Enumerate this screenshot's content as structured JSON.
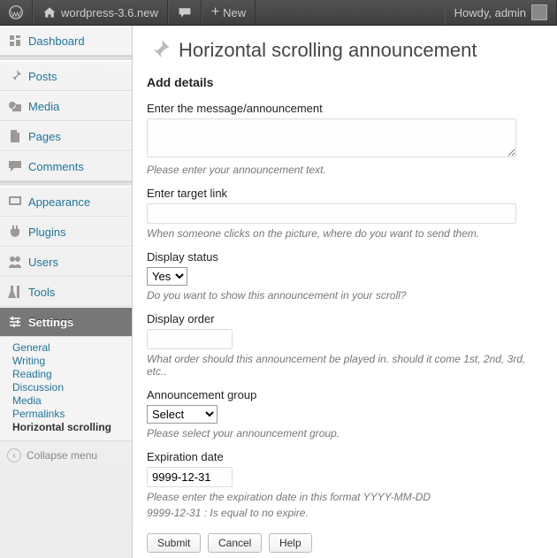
{
  "adminbar": {
    "site_name": "wordpress-3.6.new",
    "new_label": "New",
    "howdy": "Howdy, admin"
  },
  "sidebar": {
    "items": [
      {
        "label": "Dashboard",
        "icon": "dashboard"
      },
      {
        "label": "Posts",
        "icon": "pin"
      },
      {
        "label": "Media",
        "icon": "media"
      },
      {
        "label": "Pages",
        "icon": "page"
      },
      {
        "label": "Comments",
        "icon": "comment"
      },
      {
        "label": "Appearance",
        "icon": "appearance"
      },
      {
        "label": "Plugins",
        "icon": "plugin"
      },
      {
        "label": "Users",
        "icon": "users"
      },
      {
        "label": "Tools",
        "icon": "tools"
      },
      {
        "label": "Settings",
        "icon": "settings"
      }
    ],
    "settings_sub": [
      "General",
      "Writing",
      "Reading",
      "Discussion",
      "Media",
      "Permalinks",
      "Horizontal scrolling"
    ],
    "collapse": "Collapse menu"
  },
  "page": {
    "title": "Horizontal scrolling announcement",
    "section": "Add details"
  },
  "form": {
    "message": {
      "label": "Enter the message/announcement",
      "hint": "Please enter your announcement text."
    },
    "link": {
      "label": "Enter target link",
      "hint": "When someone clicks on the picture, where do you want to send them."
    },
    "status": {
      "label": "Display status",
      "value": "Yes",
      "hint": "Do you want to show this announcement in your scroll?"
    },
    "order": {
      "label": "Display order",
      "hint": "What order should this announcement be played in. should it come 1st, 2nd, 3rd, etc.."
    },
    "group": {
      "label": "Announcement group",
      "value": "Select",
      "hint": "Please select your announcement group."
    },
    "expire": {
      "label": "Expiration date",
      "value": "9999-12-31",
      "hint1": "Please enter the expiration date in this format YYYY-MM-DD",
      "hint2": "9999-12-31 : Is equal to no expire."
    },
    "buttons": {
      "submit": "Submit",
      "cancel": "Cancel",
      "help": "Help"
    }
  }
}
